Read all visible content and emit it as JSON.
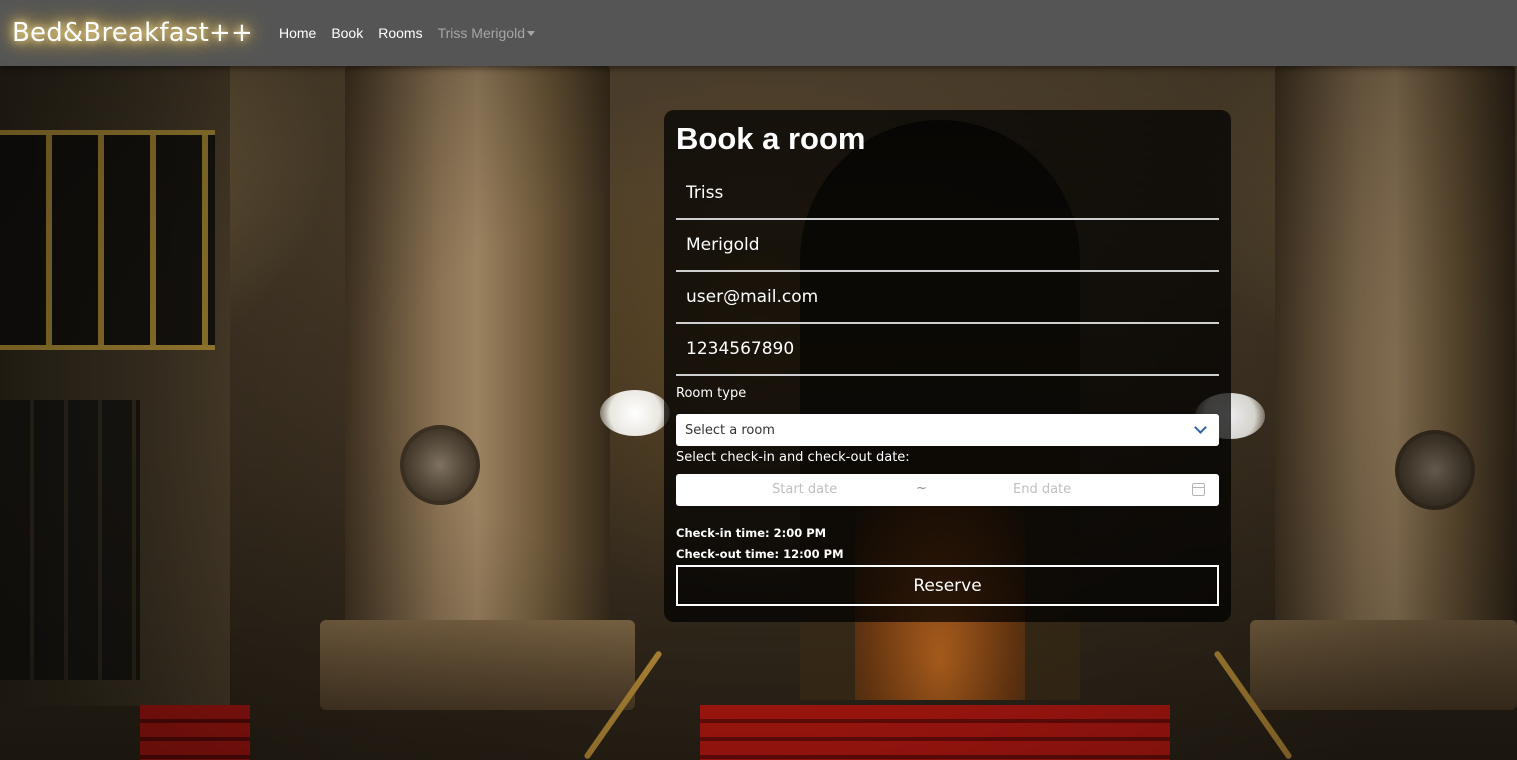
{
  "navbar": {
    "brand": "Bed&Breakfast++",
    "links": {
      "home": "Home",
      "book": "Book",
      "rooms": "Rooms"
    },
    "user_menu": "Triss Merigold"
  },
  "booking": {
    "title": "Book a room",
    "first_name": "Triss",
    "last_name": "Merigold",
    "email": "user@mail.com",
    "phone": "1234567890",
    "room_type_label": "Room type",
    "room_select_value": "Select a room",
    "dates_label": "Select check-in and check-out date:",
    "start_date_placeholder": "Start date",
    "date_separator": "~",
    "end_date_placeholder": "End date",
    "checkin_info": "Check-in time: 2:00 PM",
    "checkout_info": "Check-out time: 12:00 PM",
    "reserve_label": "Reserve"
  },
  "icons": {
    "room_dropdown": "chevron-down-icon",
    "date_picker": "calendar-icon",
    "user_menu": "caret-down-icon"
  },
  "colors": {
    "navbar_bg": "#555555",
    "card_bg": "rgba(0,0,0,0.72)",
    "accent_chevron": "#2f64a8",
    "brand_glow": "#ffcf57"
  }
}
